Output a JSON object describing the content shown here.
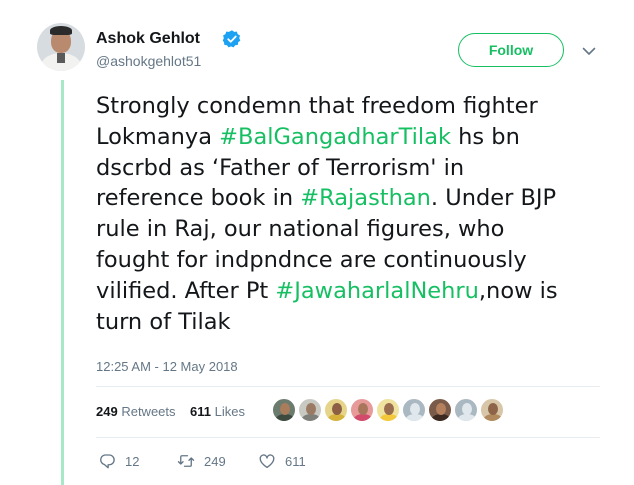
{
  "tweet": {
    "author_name": "Ashok Gehlot",
    "author_handle": "@ashokgehlot51",
    "follow_label": "Follow",
    "text_lines": [
      [
        {
          "t": "Strongly condemn that freedom fighter",
          "h": false
        }
      ],
      [
        {
          "t": "Lokmanya ",
          "h": false
        },
        {
          "t": "#BalGangadharTilak",
          "h": true
        },
        {
          "t": " hs bn",
          "h": false
        }
      ],
      [
        {
          "t": "dscrbd as ‘Father of Terrorism' in",
          "h": false
        }
      ],
      [
        {
          "t": "reference book in ",
          "h": false
        },
        {
          "t": "#Rajasthan",
          "h": true
        },
        {
          "t": ". Under BJP",
          "h": false
        }
      ],
      [
        {
          "t": "rule in Raj, our national figures, who",
          "h": false
        }
      ],
      [
        {
          "t": "fought for indpndnce are continuously",
          "h": false
        }
      ],
      [
        {
          "t": "vilified. After Pt ",
          "h": false
        },
        {
          "t": "#JawaharlalNehru",
          "h": true
        },
        {
          "t": ",now is",
          "h": false
        }
      ],
      [
        {
          "t": "turn of Tilak",
          "h": false
        }
      ]
    ],
    "timestamp": "12:25 AM - 12 May 2018"
  },
  "stats": {
    "retweets_count": "249",
    "retweets_label": "Retweets",
    "likes_count": "611",
    "likes_label": "Likes"
  },
  "liker_avatars": [
    {
      "name": "liker-avatar-1",
      "bg": "#6b7b6e",
      "head": "#a97c5c",
      "body": "#3d4a40"
    },
    {
      "name": "liker-avatar-2",
      "bg": "#c9c9c4",
      "head": "#9b7a63",
      "body": "#7f7f7a"
    },
    {
      "name": "liker-avatar-3",
      "bg": "#e6d48a",
      "head": "#8c5f44",
      "body": "#d6b23a"
    },
    {
      "name": "liker-avatar-4",
      "bg": "#e79a9a",
      "head": "#a8765a",
      "body": "#d24a6c"
    },
    {
      "name": "liker-avatar-5",
      "bg": "#f0e3a0",
      "head": "#9a6d4f",
      "body": "#f3c83a"
    },
    {
      "name": "liker-avatar-6",
      "bg": "#aab8c2",
      "head": "#e1e8ed",
      "body": "#e1e8ed"
    },
    {
      "name": "liker-avatar-7",
      "bg": "#7a5a48",
      "head": "#b4805e",
      "body": "#3c2a22"
    },
    {
      "name": "liker-avatar-8",
      "bg": "#aab8c2",
      "head": "#e1e8ed",
      "body": "#e1e8ed"
    },
    {
      "name": "liker-avatar-9",
      "bg": "#d7c6a8",
      "head": "#8e6449",
      "body": "#b08a5c"
    }
  ],
  "actions": {
    "reply_count": "12",
    "retweet_count": "249",
    "like_count": "611"
  },
  "colors": {
    "accent": "#17bf63",
    "verified": "#1da1f2",
    "secondary_text": "#657786",
    "thread_line": "#a6e8c8"
  },
  "icons": {
    "verified": "verified-badge-icon",
    "chevron": "chevron-down-icon",
    "reply": "reply-icon",
    "retweet": "retweet-icon",
    "like": "heart-icon"
  }
}
